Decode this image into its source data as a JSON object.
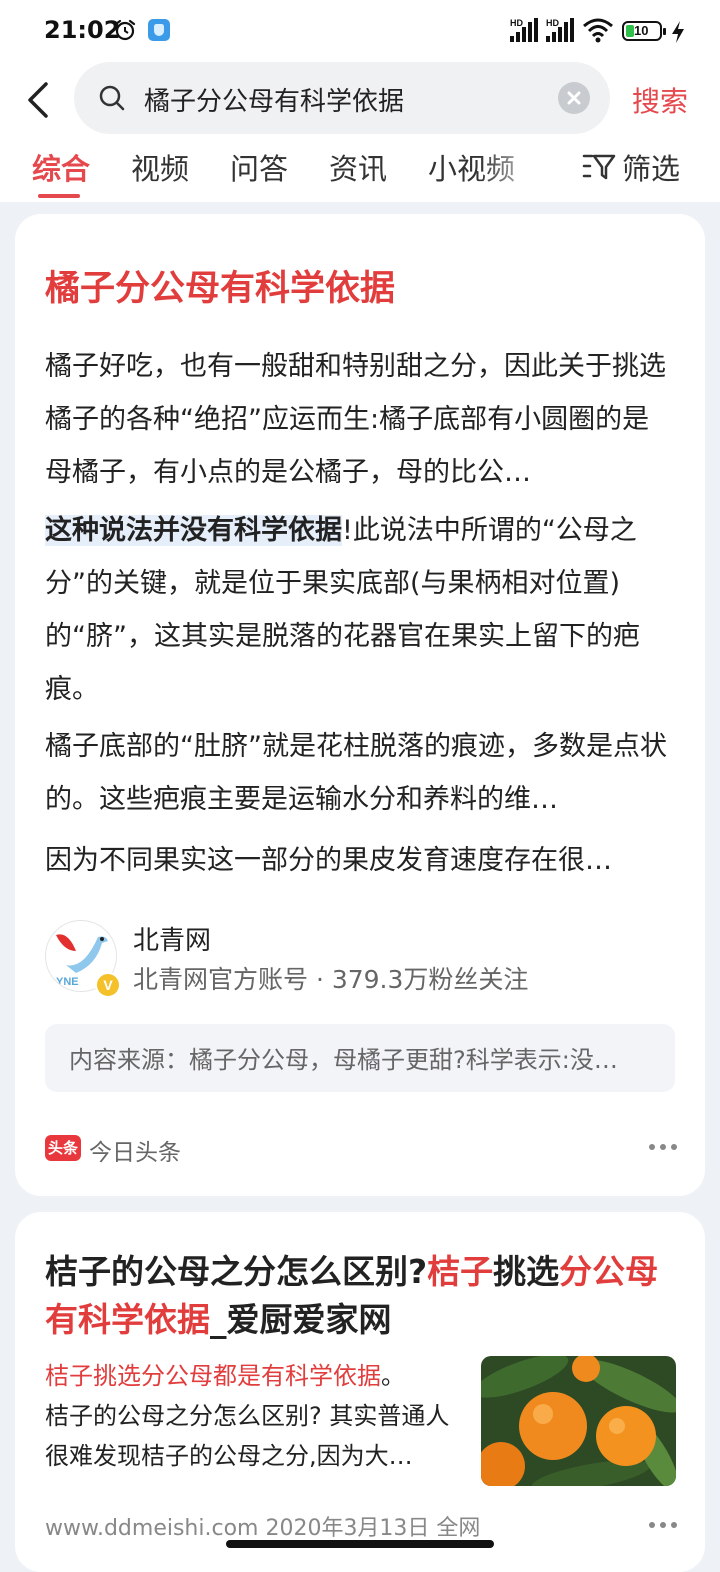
{
  "status_bar": {
    "time": "21:02",
    "sim1": "HD",
    "sim2": "HD",
    "battery": "10"
  },
  "search": {
    "query": "橘子分公母有科学依据",
    "button_label": "搜索"
  },
  "tabs": [
    {
      "label": "综合",
      "active": true
    },
    {
      "label": "视频"
    },
    {
      "label": "问答"
    },
    {
      "label": "资讯"
    },
    {
      "label": "小视频"
    }
  ],
  "filter_label": "筛选",
  "result1": {
    "title": "橘子分公母有科学依据",
    "para1": "橘子好吃，也有一般甜和特别甜之分，因此关于挑选橘子的各种“绝招”应运而生:橘子底部有小圆圈的是母橘子，有小点的是公橘子，母的比公…",
    "para2_highlight": "这种说法并没有科学依据",
    "para2_rest": "!此说法中所谓的“公母之分”的关键，就是位于果实底部(与果柄相对位置)的“脐”，这其实是脱落的花器官在果实上留下的疤痕。",
    "para3": "橘子底部的“肚脐”就是花柱脱落的痕迹，多数是点状的。这些疤痕主要是运输水分和养料的维…",
    "para4": "因为不同果实这一部分的果皮发育速度存在很…",
    "source_name": "北青网",
    "source_logo_text": "YNE",
    "source_meta": "北青网官方账号 · 379.3万粉丝关注",
    "origin": "内容来源：橘子分公母，母橘子更甜?科学表示:没…",
    "provider_badge": "头条",
    "provider": "今日头条"
  },
  "result2": {
    "title_a": "桔子的公母之分怎么区别?",
    "title_b": "桔子",
    "title_c": "挑选",
    "title_d": "分公母有科学依据",
    "title_e": "_爱厨爱家网",
    "snippet_red": "桔子挑选分公母都是有科学依据",
    "snippet_dot": "。",
    "snippet": "桔子的公母之分怎么区别? 其实普通人很难发现桔子的公母之分,因为大…",
    "meta": "www.ddmeishi.com  2020年3月13日  全网"
  },
  "colors": {
    "accent": "#e5484d",
    "title_red": "#e23d3d"
  }
}
